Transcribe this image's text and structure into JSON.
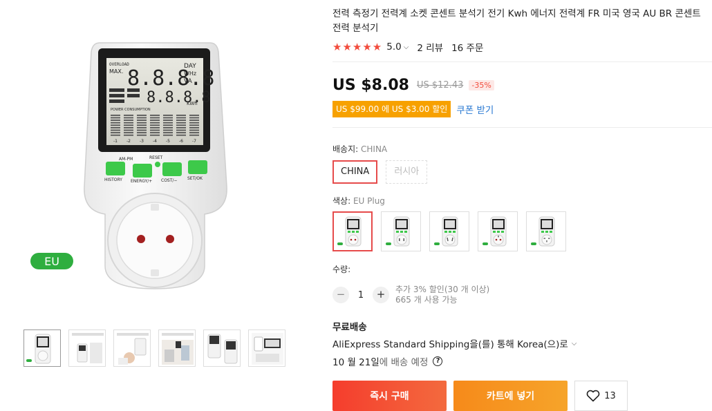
{
  "product": {
    "title": "전력 측정기 전력계 소켓 콘센트 분석기 전기 Kwh 에너지 전력계 FR 미국 영국 AU BR 콘센트 전력 분석기",
    "rating": "5.0",
    "reviews": "2 리뷰",
    "orders": "16 주문",
    "price": "US $8.08",
    "old_price": "US $12.43",
    "discount": "-35%",
    "coupon_text": "US $99.00 에 US $3.00 할인",
    "coupon_link": "쿠폰 받기"
  },
  "gallery": {
    "badge": "EU",
    "device": {
      "overload": "OVERLOAD",
      "max": "MAX.",
      "big_digits": "8.8.8.8",
      "small_digits": "8.8.8.8",
      "unit_day": "DAY",
      "unit_whz": "WHz",
      "unit_va": "VA",
      "unit_kwh": "KWh",
      "power_text": "POWER CONSUMPTION",
      "bars_scale": [
        "-1",
        "-2",
        "-3",
        "-4",
        "-5",
        "-6",
        "-7"
      ],
      "am_pm": "AM-PM",
      "reset": "RESET",
      "btn_history": "HISTORY",
      "btn_energy": "ENERGY/+",
      "btn_cost": "COST/−",
      "btn_set": "SET/OK"
    }
  },
  "shipping_from": {
    "label": "배송지:",
    "value": "CHINA",
    "options": [
      "CHINA",
      "러시아"
    ]
  },
  "color": {
    "label": "색상:",
    "value": "EU Plug",
    "count": 5
  },
  "quantity": {
    "label": "수량:",
    "value": "1",
    "minus": "−",
    "plus": "+",
    "note1": "추가 3% 할인(30 개 이상)",
    "note2": "665 개 사용 가능"
  },
  "delivery": {
    "title": "무료배송",
    "method": "AliExpress Standard Shipping을(를) 통해 Korea(으)로",
    "date": "10 월 21일",
    "date_suffix": "에 배송 예정",
    "help": "?"
  },
  "actions": {
    "buy": "즉시 구매",
    "cart": "카트에 넣기",
    "wish_count": "13"
  },
  "icons": {
    "star": "star-icon",
    "chevron": "chevron-down-icon",
    "heart": "heart-icon",
    "help": "question-circle-icon"
  },
  "colors": {
    "accent": "#e64a4a",
    "star": "#f24c3d",
    "coupon": "#f7a100",
    "link": "#2878d2",
    "device_button": "#3dc94a"
  }
}
